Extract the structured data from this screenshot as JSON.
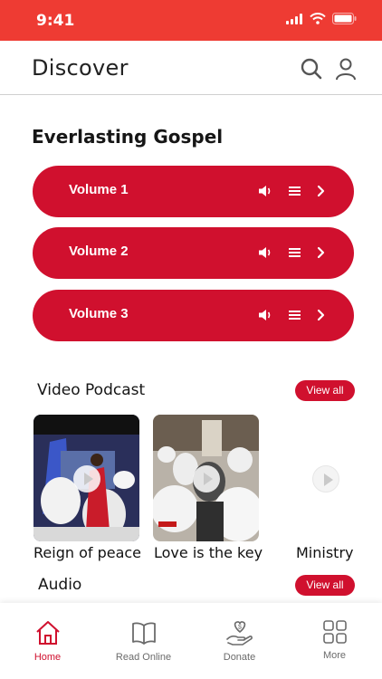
{
  "status_bar": {
    "time": "9:41"
  },
  "header": {
    "title": "Discover",
    "search_icon": "search-icon",
    "profile_icon": "user-icon"
  },
  "gospel": {
    "title": "Everlasting Gospel",
    "volumes": [
      {
        "label": "Volume 1"
      },
      {
        "label": "Volume 2"
      },
      {
        "label": "Volume 3"
      }
    ]
  },
  "video_podcast": {
    "title": "Video Podcast",
    "view_all": "View all",
    "items": [
      {
        "caption": "Reign of peace"
      },
      {
        "caption": "Love is the key"
      },
      {
        "caption": "Ministry"
      }
    ]
  },
  "audio": {
    "title": "Audio",
    "view_all": "View all"
  },
  "tabbar": {
    "tabs": [
      {
        "label": "Home",
        "icon": "home-icon",
        "active": true
      },
      {
        "label": "Read Online",
        "icon": "book-icon",
        "active": false
      },
      {
        "label": "Donate",
        "icon": "donate-hand-icon",
        "active": false
      },
      {
        "label": "More",
        "icon": "grid-icon",
        "active": false
      }
    ]
  },
  "colors": {
    "accent": "#d0102e",
    "status_bar": "#ee3b33"
  }
}
